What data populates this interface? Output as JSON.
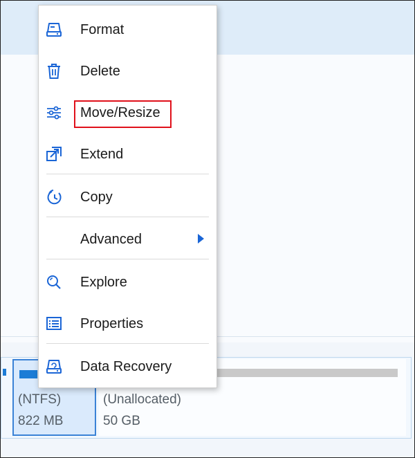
{
  "menu": {
    "items": [
      {
        "label": "Format",
        "icon": "format-disk-icon"
      },
      {
        "label": "Delete",
        "icon": "trash-icon"
      },
      {
        "label": "Move/Resize",
        "icon": "sliders-icon",
        "highlighted": true
      },
      {
        "label": "Extend",
        "icon": "extend-icon"
      },
      {
        "label": "Copy",
        "icon": "copy-clock-icon"
      },
      {
        "label": "Advanced",
        "icon": "none",
        "submenu": true
      },
      {
        "label": "Explore",
        "icon": "magnifier-icon"
      },
      {
        "label": "Properties",
        "icon": "list-icon"
      },
      {
        "label": "Data Recovery",
        "icon": "disk-recovery-icon"
      }
    ]
  },
  "partitions": {
    "ntfs": {
      "type": "(NTFS)",
      "size": "822 MB",
      "usage_fraction": 0.26
    },
    "unallocated": {
      "type": "(Unallocated)",
      "size": "50 GB"
    }
  },
  "colors": {
    "accent": "#1c7cd6",
    "highlight_border": "#e0101a",
    "icon_blue": "#1a65d6"
  }
}
